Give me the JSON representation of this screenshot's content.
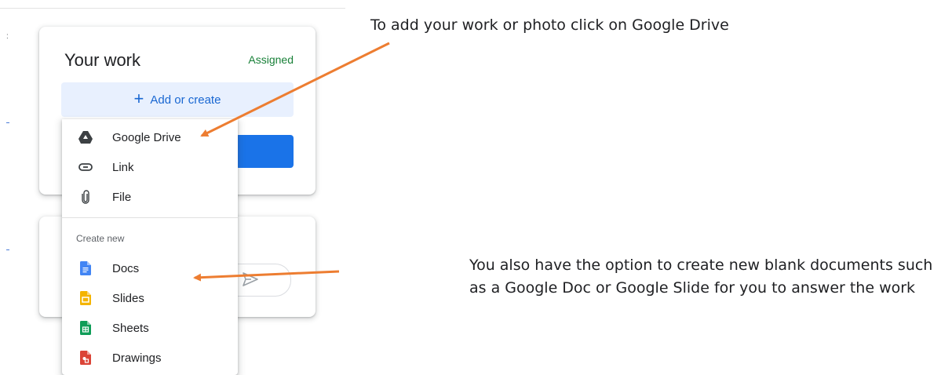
{
  "work_card": {
    "title": "Your work",
    "status": "Assigned",
    "add_button_label": "Add or create"
  },
  "menu": {
    "items": [
      {
        "label": "Google Drive",
        "icon": "google-drive-icon"
      },
      {
        "label": "Link",
        "icon": "link-icon"
      },
      {
        "label": "File",
        "icon": "paperclip-icon"
      }
    ],
    "section_label": "Create new",
    "create_items": [
      {
        "label": "Docs",
        "icon": "docs-icon",
        "color": "#4285f4"
      },
      {
        "label": "Slides",
        "icon": "slides-icon",
        "color": "#f4b400"
      },
      {
        "label": "Sheets",
        "icon": "sheets-icon",
        "color": "#0f9d58"
      },
      {
        "label": "Drawings",
        "icon": "drawings-icon",
        "color": "#db4437"
      }
    ]
  },
  "annotations": {
    "callout_1": "To add your work or photo click on Google Drive",
    "callout_2": "You also have the option to create new blank documents such as a Google Doc or Google Slide for you to answer the work",
    "arrow_color": "#ed7d31"
  },
  "colors": {
    "primary": "#1a73e8",
    "status_green": "#188038",
    "add_bg": "#e8f0fe"
  }
}
